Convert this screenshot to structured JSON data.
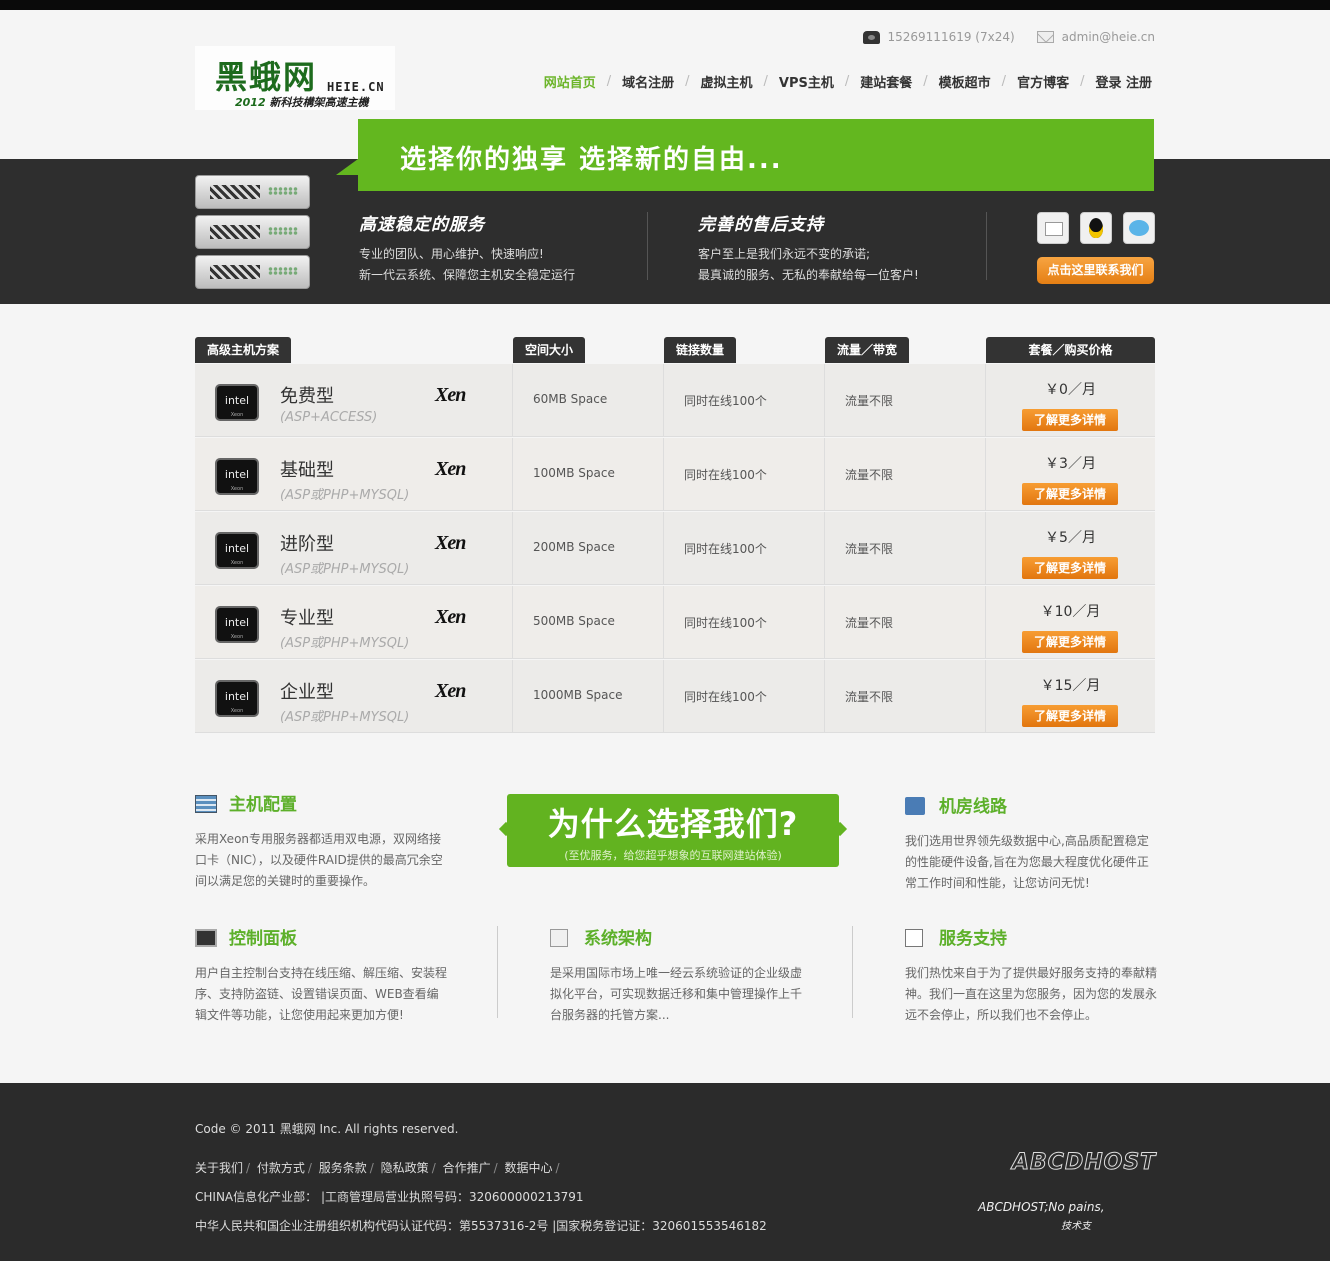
{
  "header": {
    "phone": "15269111619 (7x24)",
    "email": "admin@heie.cn",
    "logo": {
      "main": "黑蛾网",
      "en": "HEIE.CN",
      "year": "2012",
      "tagline": "新科技構架高速主機"
    },
    "nav": [
      "网站首页",
      "域名注册",
      "虚拟主机",
      "VPS主机",
      "建站套餐",
      "模板超市",
      "官方博客",
      "登录 注册"
    ]
  },
  "banner": {
    "slogan": "选择你的独享 选择新的自由...",
    "features": [
      {
        "title": "高速稳定的服务",
        "lines": [
          "专业的团队、用心维护、快速响应!",
          "新一代云系统、保障您主机安全稳定运行"
        ]
      },
      {
        "title": "完善的售后支持",
        "lines": [
          "客户至上是我们永远不变的承诺;",
          "最真诚的服务、无私的奉献给每一位客户!"
        ]
      }
    ],
    "contact_button": "点击这里联系我们"
  },
  "table": {
    "headers": [
      "高级主机方案",
      "空间大小",
      "链接数量",
      "流量／带宽",
      "套餐／购买价格"
    ],
    "chip_label": "intel",
    "chip_sub": "Xeon",
    "xen_label": "Xen",
    "more_label": "了解更多详情",
    "rows": [
      {
        "name": "免费型",
        "tech": "(ASP+ACCESS)",
        "space": "60MB Space",
        "links": "同时在线100个",
        "traffic": "流量不限",
        "price": "￥0／月"
      },
      {
        "name": "基础型",
        "tech": "(ASP或PHP+MYSQL)",
        "space": "100MB Space",
        "links": "同时在线100个",
        "traffic": "流量不限",
        "price": "￥3／月"
      },
      {
        "name": "进阶型",
        "tech": "(ASP或PHP+MYSQL)",
        "space": "200MB Space",
        "links": "同时在线100个",
        "traffic": "流量不限",
        "price": "￥5／月"
      },
      {
        "name": "专业型",
        "tech": "(ASP或PHP+MYSQL)",
        "space": "500MB Space",
        "links": "同时在线100个",
        "traffic": "流量不限",
        "price": "￥10／月"
      },
      {
        "name": "企业型",
        "tech": "(ASP或PHP+MYSQL)",
        "space": "1000MB Space",
        "links": "同时在线100个",
        "traffic": "流量不限",
        "price": "￥15／月"
      }
    ]
  },
  "features": {
    "why_title": "为什么选择我们?",
    "why_sub": "(至优服务，给您超乎想象的互联网建站体验)",
    "config": {
      "title": "主机配置",
      "text": "采用Xeon专用服务器都适用双电源，双网络接口卡（NIC），以及硬件RAID提供的最高冗余空间以满足您的关键时的重要操作。"
    },
    "room": {
      "title": "机房线路",
      "text": "我们选用世界领先级数据中心,高品质配置稳定的性能硬件设备,旨在为您最大程度优化硬件正常工作时间和性能，让您访问无忧!"
    },
    "panel": {
      "title": "控制面板",
      "text": "用户自主控制台支持在线压缩、解压缩、安装程序、支持防盗链、设置错误页面、WEB查看编辑文件等功能，让您使用起来更加方便!"
    },
    "arch": {
      "title": "系统架构",
      "text": "是采用国际市场上唯一经云系统验证的企业级虚拟化平台，可实现数据迁移和集中管理操作上千台服务器的托管方案..."
    },
    "support": {
      "title": "服务支持",
      "text": "我们热忱来自于为了提供最好服务支持的奉献精神。我们一直在这里为您服务，因为您的发展永远不会停止，所以我们也不会停止。"
    }
  },
  "footer": {
    "copyright": "Code © 2011 黑蛾网 Inc. All rights reserved.",
    "links": [
      "关于我们",
      "付款方式",
      "服务条款",
      "隐私政策",
      "合作推广",
      "数据中心"
    ],
    "line3": "CHINA信息化产业部：  |工商管理局营业执照号码：320600000213791",
    "line4": "中华人民共和国企业注册组织机构代码认证代码：第5537316-2号 |国家税务登记证：320601553546182",
    "brand": "ABCDHOST",
    "tag1": "ABCDHOST;No pains,",
    "tag2": "技术支"
  },
  "colors": {
    "accent": "#63b71f",
    "button": "#e57f14",
    "dark": "#2e2e2e"
  }
}
